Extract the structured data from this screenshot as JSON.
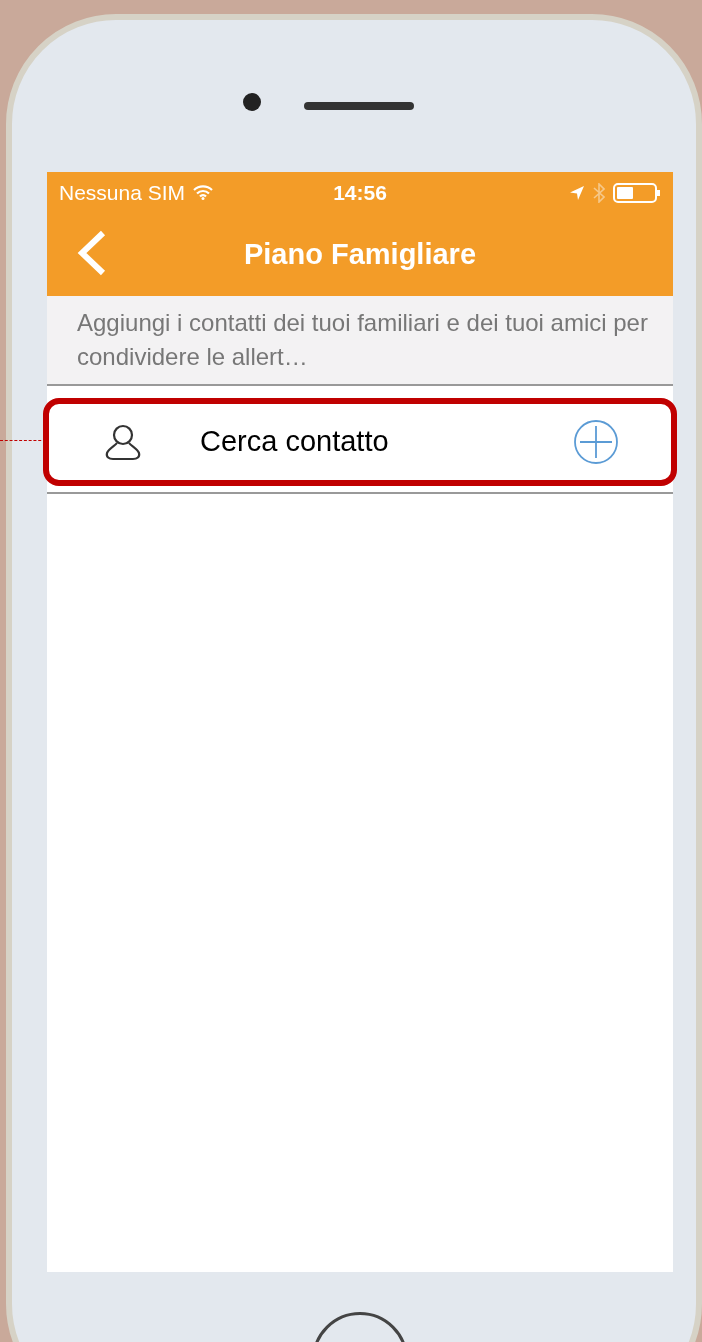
{
  "status_bar": {
    "carrier": "Nessuna SIM",
    "time": "14:56"
  },
  "nav_bar": {
    "title": "Piano Famigliare"
  },
  "description": "Aggiungi i contatti dei tuoi familiari e dei tuoi amici per condividere le allert…",
  "contact_row": {
    "label": "Cerca contatto",
    "highlighted": true
  }
}
